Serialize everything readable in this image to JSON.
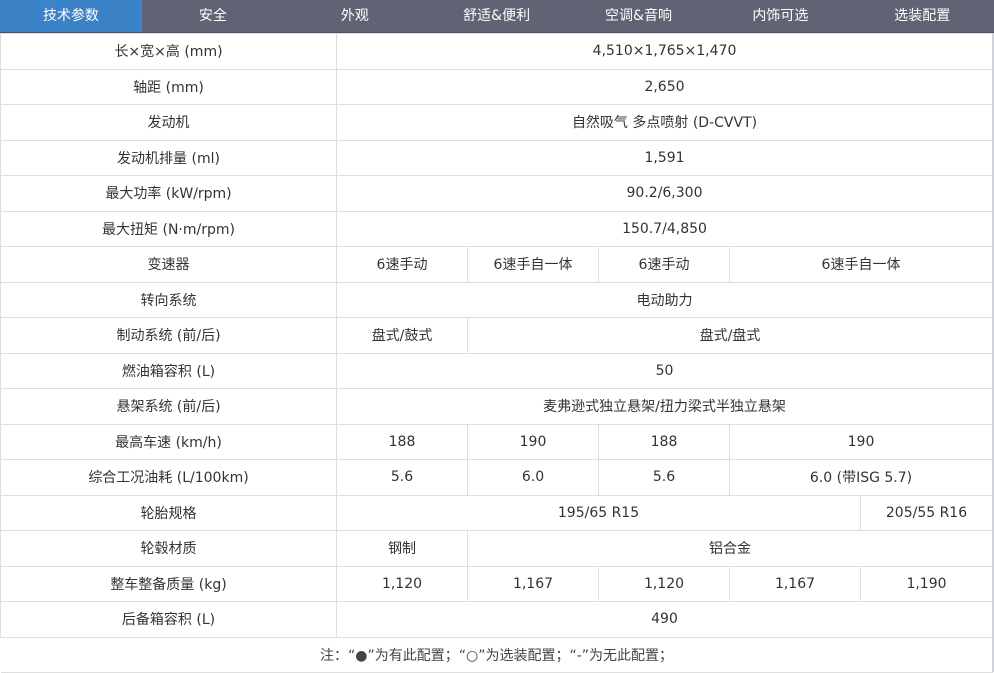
{
  "tabs": [
    {
      "label": "技术参数",
      "active": true
    },
    {
      "label": "安全",
      "active": false
    },
    {
      "label": "外观",
      "active": false
    },
    {
      "label": "舒适&便利",
      "active": false
    },
    {
      "label": "空调&音响",
      "active": false
    },
    {
      "label": "内饰可选",
      "active": false
    },
    {
      "label": "选装配置",
      "active": false
    }
  ],
  "rows": [
    {
      "label": "长×宽×高 (mm)",
      "cells": [
        {
          "text": "4,510×1,765×1,470",
          "span": 5
        }
      ]
    },
    {
      "label": "轴距 (mm)",
      "cells": [
        {
          "text": "2,650",
          "span": 5
        }
      ]
    },
    {
      "label": "发动机",
      "cells": [
        {
          "text": "自然吸气 多点喷射 (D-CVVT)",
          "span": 5
        }
      ]
    },
    {
      "label": "发动机排量 (ml)",
      "cells": [
        {
          "text": "1,591",
          "span": 5
        }
      ]
    },
    {
      "label": "最大功率 (kW/rpm)",
      "cells": [
        {
          "text": "90.2/6,300",
          "span": 5
        }
      ]
    },
    {
      "label": "最大扭矩 (N·m/rpm)",
      "cells": [
        {
          "text": "150.7/4,850",
          "span": 5
        }
      ]
    },
    {
      "label": "变速器",
      "cells": [
        {
          "text": "6速手动",
          "span": 1
        },
        {
          "text": "6速手自一体",
          "span": 1
        },
        {
          "text": "6速手动",
          "span": 1
        },
        {
          "text": "6速手自一体",
          "span": 2
        }
      ]
    },
    {
      "label": "转向系统",
      "cells": [
        {
          "text": "电动助力",
          "span": 5
        }
      ]
    },
    {
      "label": "制动系统 (前/后)",
      "cells": [
        {
          "text": "盘式/鼓式",
          "span": 1
        },
        {
          "text": "盘式/盘式",
          "span": 4
        }
      ]
    },
    {
      "label": "燃油箱容积 (L)",
      "cells": [
        {
          "text": "50",
          "span": 5
        }
      ]
    },
    {
      "label": "悬架系统 (前/后)",
      "cells": [
        {
          "text": "麦弗逊式独立悬架/扭力梁式半独立悬架",
          "span": 5
        }
      ]
    },
    {
      "label": "最高车速 (km/h)",
      "cells": [
        {
          "text": "188",
          "span": 1
        },
        {
          "text": "190",
          "span": 1
        },
        {
          "text": "188",
          "span": 1
        },
        {
          "text": "190",
          "span": 2
        }
      ]
    },
    {
      "label": "综合工况油耗 (L/100km)",
      "cells": [
        {
          "text": "5.6",
          "span": 1
        },
        {
          "text": "6.0",
          "span": 1
        },
        {
          "text": "5.6",
          "span": 1
        },
        {
          "text": "6.0 (带ISG 5.7)",
          "span": 2
        }
      ]
    },
    {
      "label": "轮胎规格",
      "cells": [
        {
          "text": "195/65 R15",
          "span": 4
        },
        {
          "text": "205/55 R16",
          "span": 1
        }
      ]
    },
    {
      "label": "轮毂材质",
      "cells": [
        {
          "text": "钢制",
          "span": 1
        },
        {
          "text": "铝合金",
          "span": 4
        }
      ]
    },
    {
      "label": "整车整备质量 (kg)",
      "cells": [
        {
          "text": "1,120",
          "span": 1
        },
        {
          "text": "1,167",
          "span": 1
        },
        {
          "text": "1,120",
          "span": 1
        },
        {
          "text": "1,167",
          "span": 1
        },
        {
          "text": "1,190",
          "span": 1
        }
      ]
    },
    {
      "label": "后备箱容积 (L)",
      "cells": [
        {
          "text": "490",
          "span": 5
        }
      ]
    }
  ],
  "note": "注：“●”为有此配置；“○”为选装配置；“-”为无此配置；",
  "colors": {
    "tab_bar": "#5f6373",
    "tab_active": "#3b82c6",
    "border": "#dedede"
  }
}
